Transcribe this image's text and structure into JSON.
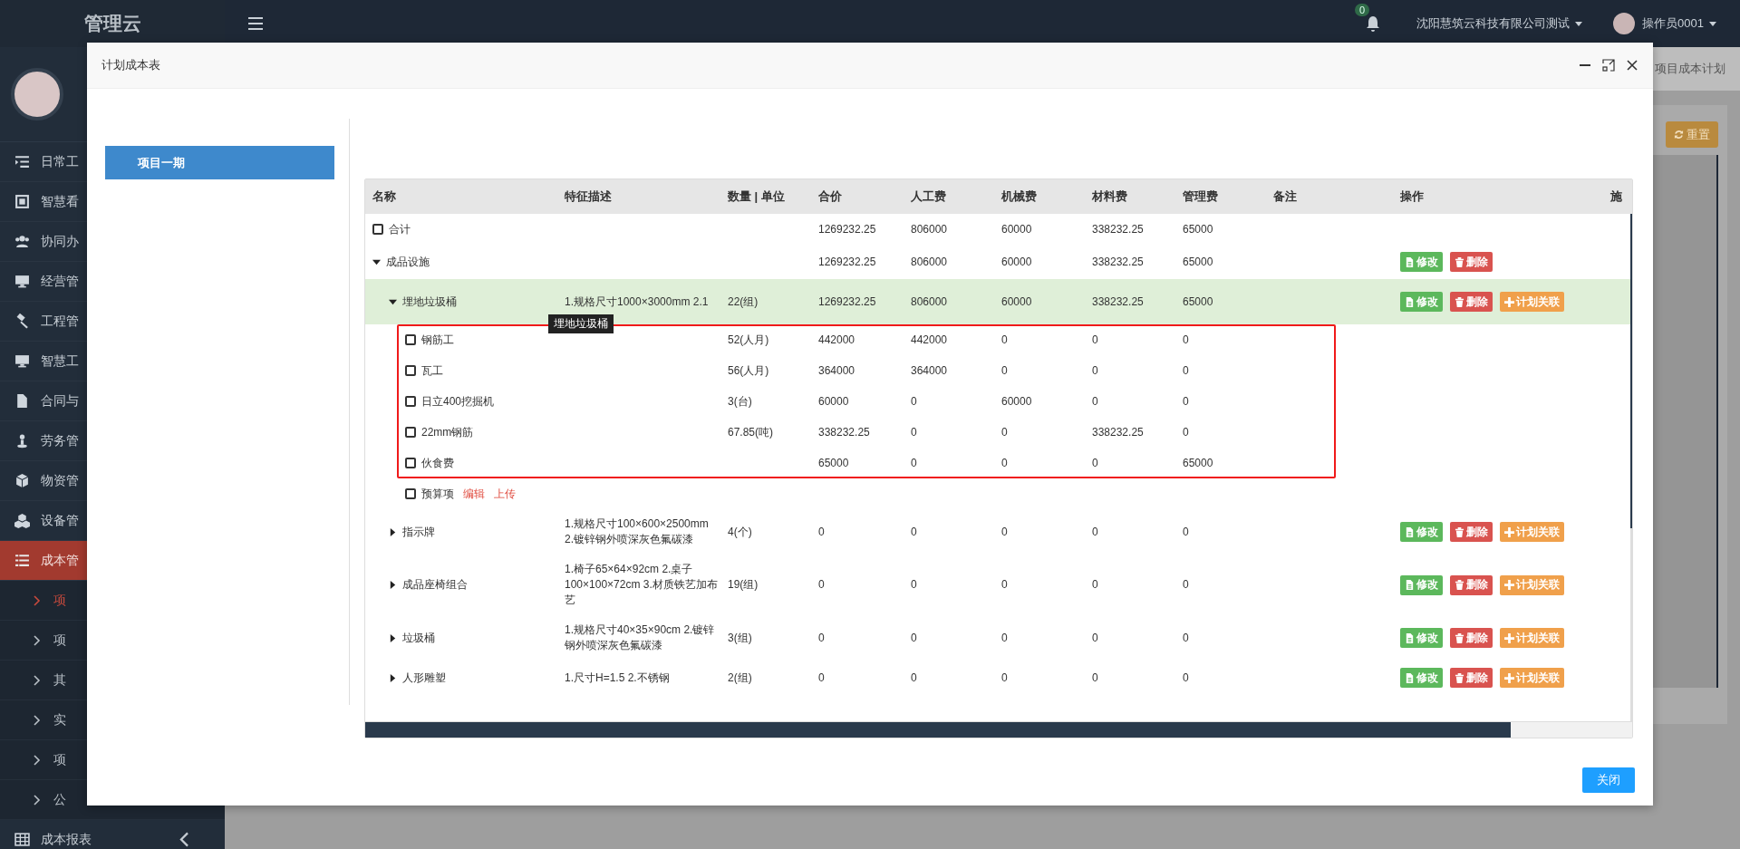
{
  "sidebar": {
    "logo": "管理云",
    "menu": [
      {
        "label": "日常工",
        "selected": false
      },
      {
        "label": "智慧看",
        "selected": false
      },
      {
        "label": "协同办",
        "selected": false
      },
      {
        "label": "经营管",
        "selected": false
      },
      {
        "label": "工程管",
        "selected": false
      },
      {
        "label": "智慧工",
        "selected": false
      },
      {
        "label": "合同与",
        "selected": false
      },
      {
        "label": "劳务管",
        "selected": false
      },
      {
        "label": "物资管",
        "selected": false
      },
      {
        "label": "设备管",
        "selected": false
      },
      {
        "label": "成本管",
        "selected": true,
        "children": [
          {
            "label": "项",
            "selected": true
          },
          {
            "label": "项",
            "selected": false
          },
          {
            "label": "其",
            "selected": false
          },
          {
            "label": "实",
            "selected": false
          },
          {
            "label": "项",
            "selected": false
          },
          {
            "label": "公",
            "selected": false
          }
        ]
      },
      {
        "label": "成本报表",
        "selected": false,
        "expanded": false
      }
    ]
  },
  "topbar": {
    "notifications": "0",
    "company": "沈阳慧筑云科技有限公司测试",
    "user": "操作员0001"
  },
  "background": {
    "breadcrumb": "项目成本计划",
    "reset_button": "重置"
  },
  "modal": {
    "title": "计划成本表",
    "projects": [
      {
        "label": "项目一期",
        "selected": true
      }
    ],
    "table": {
      "columns": [
        "名称",
        "特征描述",
        "数量 | 单位",
        "合价",
        "人工费",
        "机械费",
        "材料费",
        "管理费",
        "备注",
        "操作",
        "施"
      ],
      "rows": [
        {
          "kind": "leaf",
          "name": "合计",
          "checked": false,
          "total": "1269232.25",
          "labor": "806000",
          "machine": "60000",
          "material": "338232.25",
          "mgmt": "65000"
        },
        {
          "kind": "node",
          "name": "成品设施",
          "expanded": true,
          "selected": false,
          "total": "1269232.25",
          "labor": "806000",
          "machine": "60000",
          "material": "338232.25",
          "mgmt": "65000",
          "actions": [
            {
              "kind": "edit",
              "label": "修改"
            },
            {
              "kind": "delete",
              "label": "删除"
            }
          ],
          "children": [
            {
              "kind": "node",
              "name": "埋地垃圾桶",
              "expanded": true,
              "selected": true,
              "desc": "1.规格尺寸1000×3000mm 2.1",
              "tooltip": "埋地垃圾桶",
              "qty": "22(组)",
              "total": "1269232.25",
              "labor": "806000",
              "machine": "60000",
              "material": "338232.25",
              "mgmt": "65000",
              "actions": [
                {
                  "kind": "edit",
                  "label": "修改"
                },
                {
                  "kind": "delete",
                  "label": "删除"
                },
                {
                  "kind": "link",
                  "label": "计划关联"
                }
              ],
              "children": [
                {
                  "kind": "leaf",
                  "name": "钢筋工",
                  "checked": false,
                  "highlighted": true,
                  "qty": "52(人月)",
                  "total": "442000",
                  "labor": "442000",
                  "machine": "0",
                  "material": "0",
                  "mgmt": "0"
                },
                {
                  "kind": "leaf",
                  "name": "瓦工",
                  "checked": false,
                  "highlighted": true,
                  "qty": "56(人月)",
                  "total": "364000",
                  "labor": "364000",
                  "machine": "0",
                  "material": "0",
                  "mgmt": "0"
                },
                {
                  "kind": "leaf",
                  "name": "日立400挖掘机",
                  "checked": false,
                  "highlighted": true,
                  "qty": "3(台)",
                  "total": "60000",
                  "labor": "0",
                  "machine": "60000",
                  "material": "0",
                  "mgmt": "0"
                },
                {
                  "kind": "leaf",
                  "name": "22mm钢筋",
                  "checked": false,
                  "highlighted": true,
                  "qty": "67.85(吨)",
                  "total": "338232.25",
                  "labor": "0",
                  "machine": "0",
                  "material": "338232.25",
                  "mgmt": "0"
                },
                {
                  "kind": "leaf",
                  "name": "伙食费",
                  "checked": false,
                  "highlighted": true,
                  "total": "65000",
                  "labor": "0",
                  "machine": "0",
                  "material": "0",
                  "mgmt": "65000"
                },
                {
                  "kind": "budget",
                  "name": "预算项",
                  "checked": false,
                  "links": [
                    "编辑",
                    "上传"
                  ]
                }
              ]
            },
            {
              "kind": "node",
              "name": "指示牌",
              "expanded": false,
              "selected": false,
              "desc": "1.规格尺寸100×600×2500mm 2.镀锌钢外喷深灰色氟碳漆",
              "qty": "4(个)",
              "total": "0",
              "labor": "0",
              "machine": "0",
              "material": "0",
              "mgmt": "0",
              "actions": [
                {
                  "kind": "edit",
                  "label": "修改"
                },
                {
                  "kind": "delete",
                  "label": "删除"
                },
                {
                  "kind": "link",
                  "label": "计划关联"
                }
              ]
            },
            {
              "kind": "node",
              "name": "成品座椅组合",
              "expanded": false,
              "selected": false,
              "desc": "1.椅子65×64×92cm 2.桌子100×100×72cm 3.材质铁艺加布艺",
              "qty": "19(组)",
              "total": "0",
              "labor": "0",
              "machine": "0",
              "material": "0",
              "mgmt": "0",
              "actions": [
                {
                  "kind": "edit",
                  "label": "修改"
                },
                {
                  "kind": "delete",
                  "label": "删除"
                },
                {
                  "kind": "link",
                  "label": "计划关联"
                }
              ]
            },
            {
              "kind": "node",
              "name": "垃圾桶",
              "expanded": false,
              "selected": false,
              "desc": "1.规格尺寸40×35×90cm 2.镀锌钢外喷深灰色氟碳漆",
              "qty": "3(组)",
              "total": "0",
              "labor": "0",
              "machine": "0",
              "material": "0",
              "mgmt": "0",
              "actions": [
                {
                  "kind": "edit",
                  "label": "修改"
                },
                {
                  "kind": "delete",
                  "label": "删除"
                },
                {
                  "kind": "link",
                  "label": "计划关联"
                }
              ]
            },
            {
              "kind": "node",
              "name": "人形雕塑",
              "expanded": false,
              "selected": false,
              "desc": "1.尺寸H=1.5 2.不锈钢",
              "qty": "2(组)",
              "total": "0",
              "labor": "0",
              "machine": "0",
              "material": "0",
              "mgmt": "0",
              "actions": [
                {
                  "kind": "edit",
                  "label": "修改"
                },
                {
                  "kind": "delete",
                  "label": "删除"
                },
                {
                  "kind": "link",
                  "label": "计划关联"
                }
              ]
            }
          ]
        }
      ]
    },
    "close_button": "关闭"
  }
}
